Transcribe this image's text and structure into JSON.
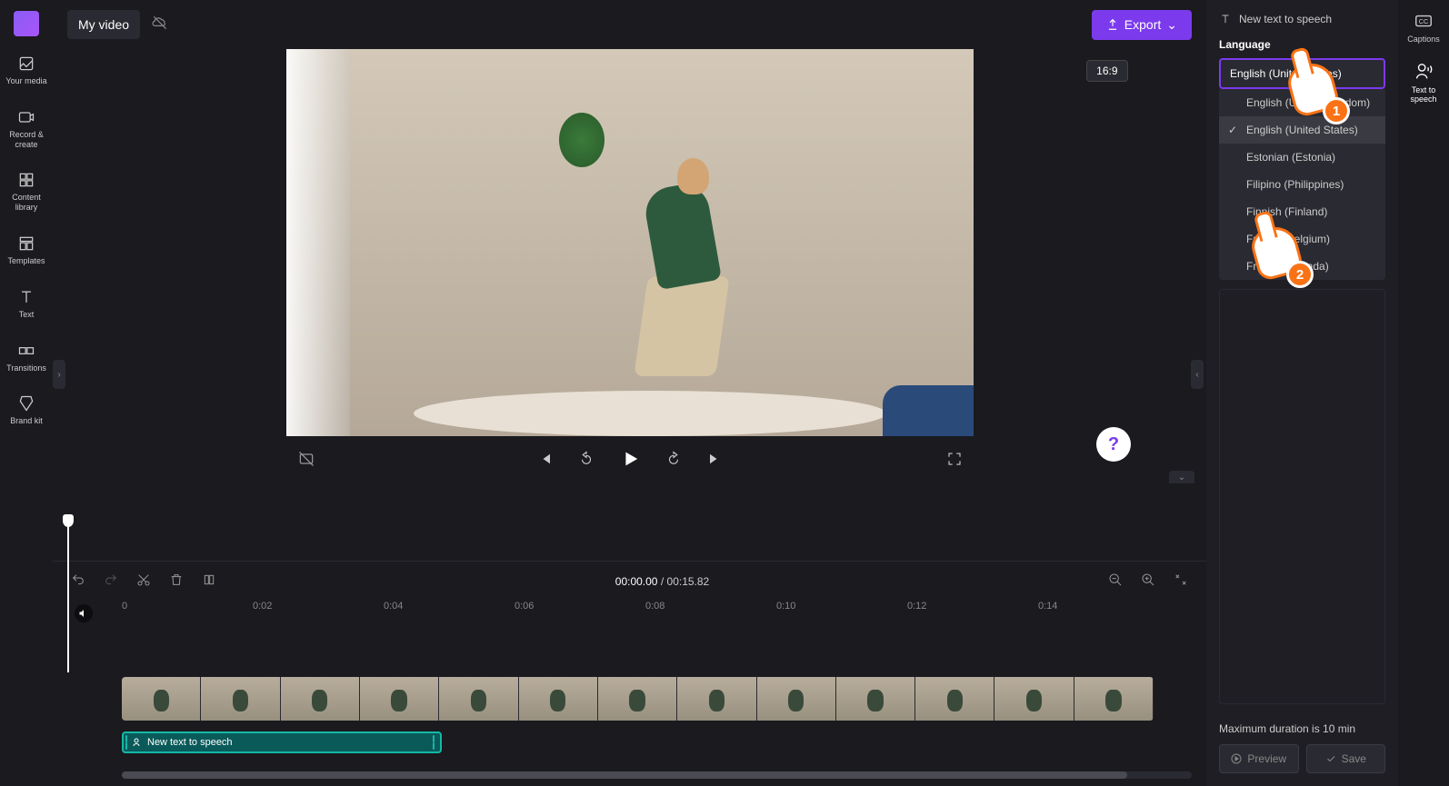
{
  "header": {
    "title": "My video",
    "export_label": "Export"
  },
  "left_sidebar": {
    "items": [
      {
        "label": "Your media"
      },
      {
        "label": "Record & create"
      },
      {
        "label": "Content library"
      },
      {
        "label": "Templates"
      },
      {
        "label": "Text"
      },
      {
        "label": "Transitions"
      },
      {
        "label": "Brand kit"
      }
    ]
  },
  "preview": {
    "aspect_ratio": "16:9"
  },
  "player": {
    "current_time": "00:00.00",
    "separator": "/",
    "duration": "00:15.82"
  },
  "timeline": {
    "ruler": [
      "0",
      "0:02",
      "0:04",
      "0:06",
      "0:08",
      "0:10",
      "0:12",
      "0:14"
    ],
    "tts_label": "New text to speech"
  },
  "right_panel": {
    "header": "New text to speech",
    "language_label": "Language",
    "selected_language": "English (United States)",
    "options": [
      "English (United Kingdom)",
      "English (United States)",
      "Estonian (Estonia)",
      "Filipino (Philippines)",
      "Finnish (Finland)",
      "French (Belgium)",
      "French (Canada)"
    ],
    "max_duration": "Maximum duration is 10 min",
    "preview_label": "Preview",
    "save_label": "Save"
  },
  "far_right": {
    "captions_label": "Captions",
    "tts_label": "Text to speech"
  },
  "pointers": {
    "p1": "1",
    "p2": "2"
  }
}
